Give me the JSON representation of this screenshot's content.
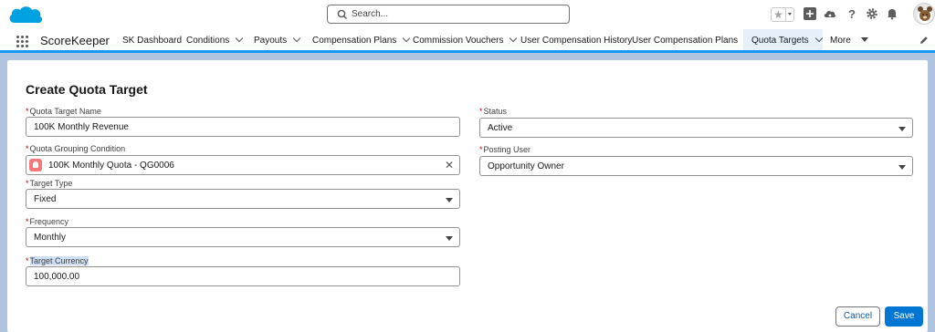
{
  "header": {
    "search_placeholder": "Search...",
    "icons": [
      "cloud-logo",
      "search-icon",
      "favorites-star-icon",
      "add-icon",
      "setup-cloud-icon",
      "help-icon",
      "gear-icon",
      "bell-icon",
      "user-avatar"
    ]
  },
  "nav": {
    "app_name": "ScoreKeeper",
    "tabs": [
      {
        "label": "SK Dashboard",
        "has_menu": false
      },
      {
        "label": "Conditions",
        "has_menu": true
      },
      {
        "label": "Payouts",
        "has_menu": true
      },
      {
        "label": "Compensation Plans",
        "has_menu": true
      },
      {
        "label": "Commission Vouchers",
        "has_menu": true
      },
      {
        "label": "User Compensation History",
        "has_menu": false
      },
      {
        "label": "User Compensation Plans",
        "has_menu": true
      },
      {
        "label": "Quota Targets",
        "has_menu": true,
        "active": true
      },
      {
        "label": "More",
        "has_menu": true
      }
    ]
  },
  "form": {
    "title": "Create Quota Target",
    "required_marker": "*",
    "fields": {
      "quota_target_name": {
        "label": "Quota Target Name",
        "value": "100K Monthly Revenue"
      },
      "quota_grouping_condition": {
        "label": "Quota Grouping Condition",
        "value": "100K Monthly Quota - QG0006"
      },
      "target_type": {
        "label": "Target Type",
        "value": "Fixed"
      },
      "frequency": {
        "label": "Frequency",
        "value": "Monthly"
      },
      "target_currency": {
        "label": "Target Currency",
        "value": "100,000.00"
      },
      "status": {
        "label": "Status",
        "value": "Active"
      },
      "posting_user": {
        "label": "Posting User",
        "value": "Opportunity Owner"
      }
    },
    "cancel_label": "Cancel",
    "save_label": "Save"
  },
  "colors": {
    "brand_blue": "#0176d3",
    "nav_active_bg": "#e5f0fb",
    "required_red": "#ba0517",
    "background": "#b0c4df"
  }
}
